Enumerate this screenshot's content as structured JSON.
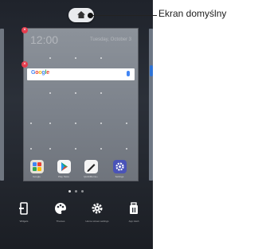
{
  "callout": {
    "label": "Ekran domyślny"
  },
  "preview": {
    "time_text": "12:00",
    "date_text": "Tuesday, October 3",
    "search_logo": "Google",
    "icons": [
      "home-icon",
      "remove-icon",
      "mic-icon"
    ]
  },
  "apps": [
    {
      "label": "Google",
      "icon": "google-folder-icon",
      "color": "#e8e3d8"
    },
    {
      "label": "Play Store",
      "icon": "play-store-icon",
      "color": "#f7f7f7"
    },
    {
      "label": "QuickMemo+",
      "icon": "pen-icon",
      "color": "#f4f4f4"
    },
    {
      "label": "Settings",
      "icon": "settings-icon",
      "color": "#4a53b8"
    }
  ],
  "tools": [
    {
      "label": "Widgets",
      "icon": "widgets-icon"
    },
    {
      "label": "Themes",
      "icon": "palette-icon"
    },
    {
      "label": "Home screen settings",
      "icon": "gear-icon"
    },
    {
      "label": "App trash",
      "icon": "trash-icon"
    }
  ],
  "colors": {
    "remove_badge": "#e53c4d",
    "screen_bg": "#2b3039",
    "preview_bg": "#7c828b"
  }
}
